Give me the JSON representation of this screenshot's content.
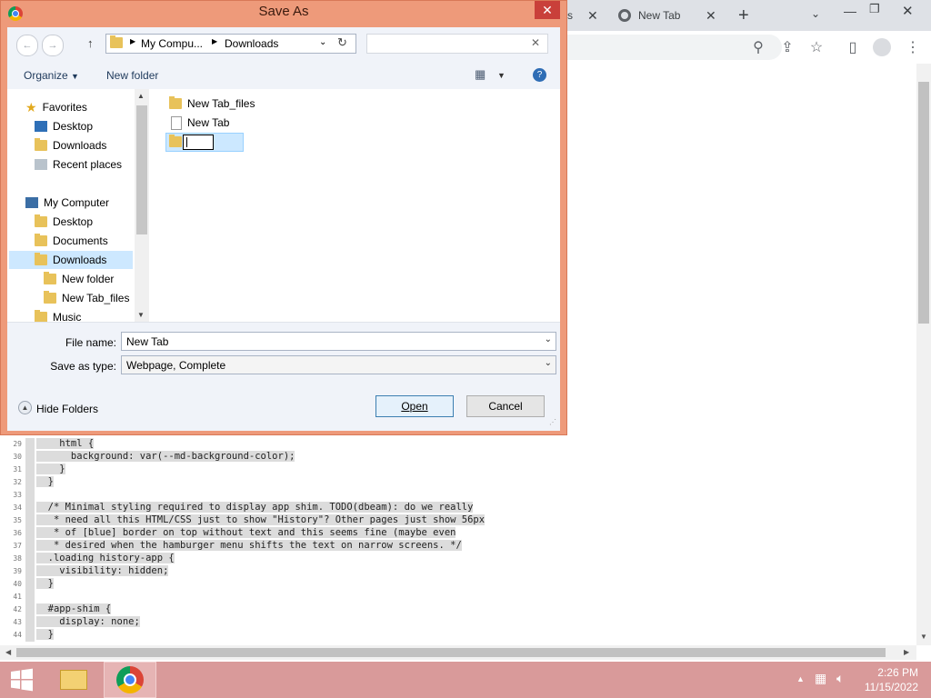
{
  "browser": {
    "tabs": [
      {
        "label": "s"
      },
      {
        "label": "New Tab"
      }
    ],
    "new_tab_icon": "plus-icon",
    "menu_icon": "kebab-menu-icon"
  },
  "source": {
    "lines": [
      {
        "n": "29",
        "text": "    html {",
        "hl": true
      },
      {
        "n": "30",
        "text": "      background: var(--md-background-color);",
        "hl": true
      },
      {
        "n": "31",
        "text": "    }",
        "hl": true
      },
      {
        "n": "32",
        "text": "  }",
        "hl": true
      },
      {
        "n": "33",
        "text": "",
        "hl": false
      },
      {
        "n": "34",
        "text": "  /* Minimal styling required to display app shim. TODO(dbeam): do we really",
        "hl": true
      },
      {
        "n": "35",
        "text": "   * need all this HTML/CSS just to show \"History\"? Other pages just show 56px",
        "hl": true
      },
      {
        "n": "36",
        "text": "   * of [blue] border on top without text and this seems fine (maybe even",
        "hl": true
      },
      {
        "n": "37",
        "text": "   * desired when the hamburger menu shifts the text on narrow screens. */",
        "hl": true
      },
      {
        "n": "38",
        "text": "  .loading history-app {",
        "hl": true
      },
      {
        "n": "39",
        "text": "    visibility: hidden;",
        "hl": true
      },
      {
        "n": "40",
        "text": "  }",
        "hl": true
      },
      {
        "n": "41",
        "text": "",
        "hl": false
      },
      {
        "n": "42",
        "text": "  #app-shim {",
        "hl": true
      },
      {
        "n": "43",
        "text": "    display: none;",
        "hl": true
      },
      {
        "n": "44",
        "text": "  }",
        "hl": true
      }
    ]
  },
  "dialog": {
    "title": "Save As",
    "breadcrumb": [
      "My Compu...",
      "Downloads"
    ],
    "search_placeholder": "",
    "organize_label": "Organize",
    "new_folder_label": "New folder",
    "nav": {
      "favorites_label": "Favorites",
      "favorites": [
        "Desktop",
        "Downloads",
        "Recent places"
      ],
      "computer_label": "My Computer",
      "computer": [
        "Desktop",
        "Documents",
        "Downloads"
      ],
      "downloads_children": [
        "New folder",
        "New Tab_files"
      ],
      "more": "Music"
    },
    "files": [
      {
        "name": "New Tab_files",
        "kind": "folder"
      },
      {
        "name": "New Tab",
        "kind": "file"
      }
    ],
    "file_name_label": "File name:",
    "file_name_value": "New Tab",
    "save_type_label": "Save as type:",
    "save_type_value": "Webpage, Complete",
    "hide_folders_label": "Hide Folders",
    "open_label": "Open",
    "cancel_label": "Cancel"
  },
  "taskbar": {
    "time": "2:26 PM",
    "date": "11/15/2022"
  }
}
